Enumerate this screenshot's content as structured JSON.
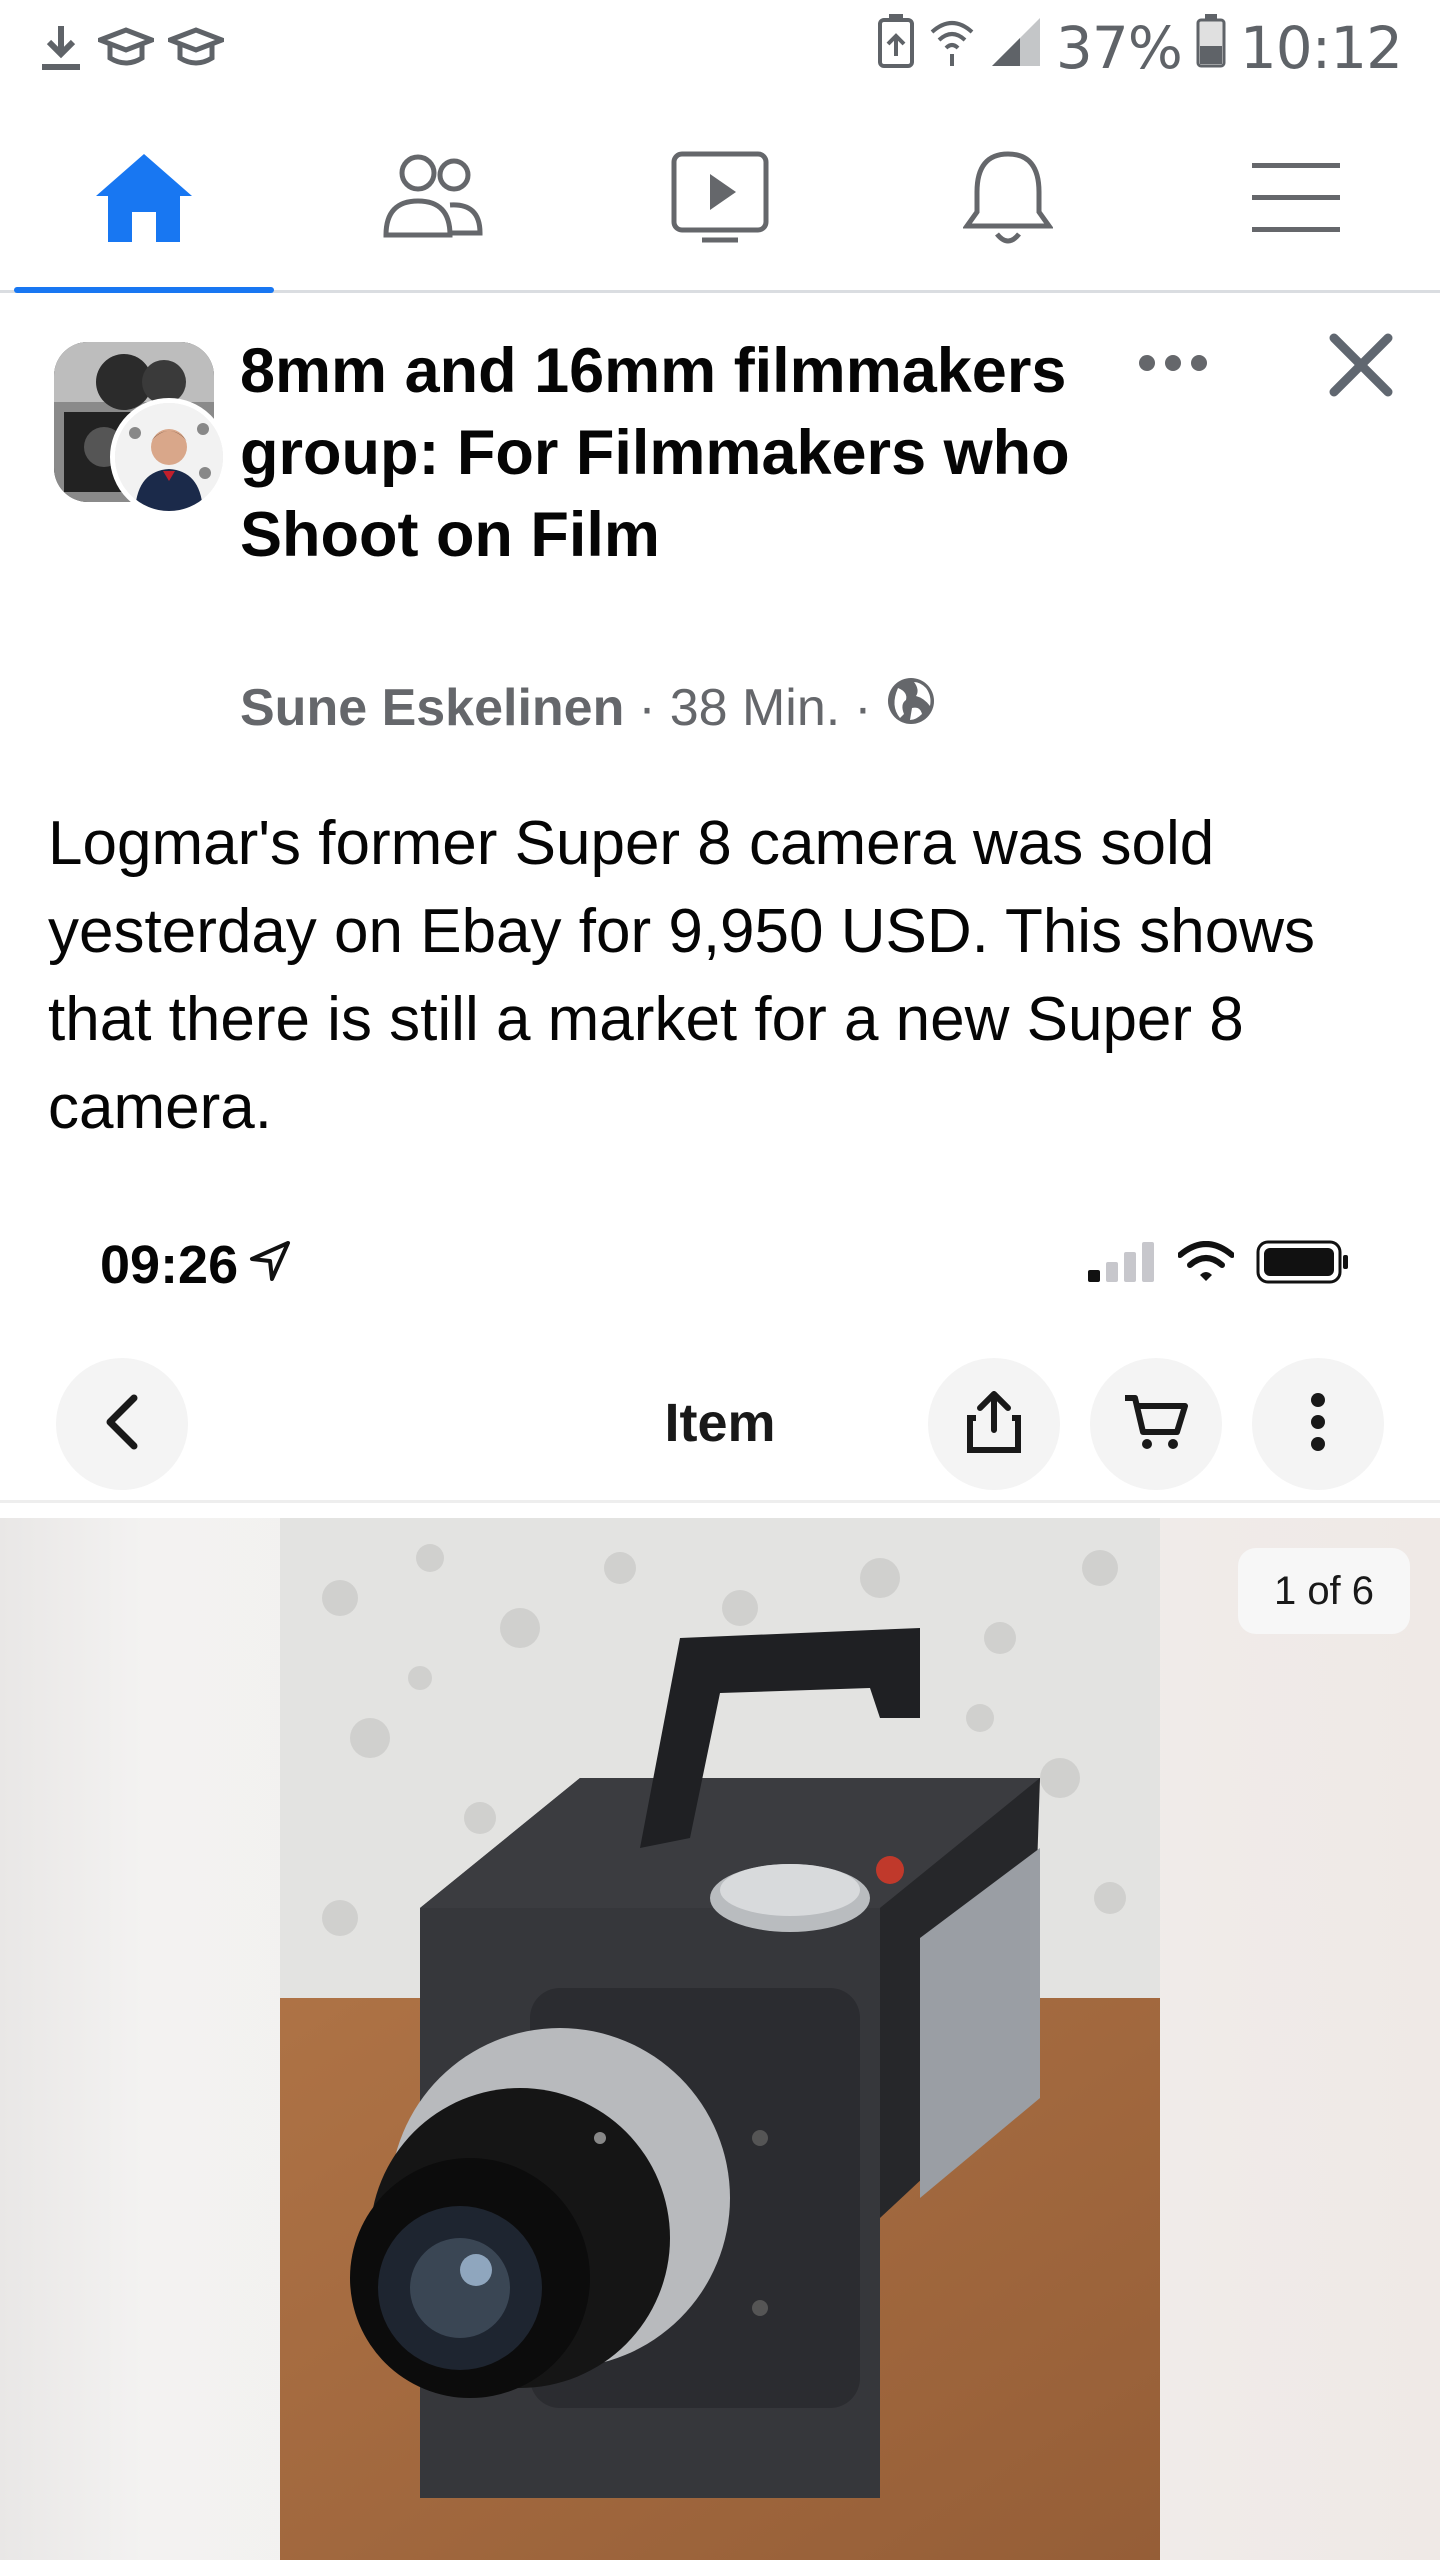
{
  "status_bar": {
    "battery": "37%",
    "time": "10:12",
    "left_icons": [
      "download-icon",
      "graduation-cap-icon",
      "graduation-cap-icon"
    ],
    "right_icons": [
      "battery-saver-icon",
      "wifi-calling-icon",
      "signal-icon",
      "battery-icon"
    ]
  },
  "nav": {
    "tabs": [
      {
        "icon": "home-icon",
        "active": true
      },
      {
        "icon": "friends-icon",
        "active": false
      },
      {
        "icon": "watch-icon",
        "active": false
      },
      {
        "icon": "notifications-bell-icon",
        "active": false
      },
      {
        "icon": "menu-icon",
        "active": false
      }
    ],
    "accent_color": "#1877f2"
  },
  "post": {
    "group_name": "8mm and 16mm filmmakers group: For Filmmakers who Shoot on Film",
    "author": "Sune Eskelinen",
    "separator": "·",
    "time_ago": "38 Min.",
    "privacy_icon": "globe-icon",
    "text": "Logmar's former Super 8 camera was sold yesterday on Ebay for 9,950 USD. This shows that there is still a market for a new Super 8 camera."
  },
  "embedded_screenshot": {
    "time": "09:26",
    "location_icon": "location-arrow-icon",
    "header_title": "Item",
    "buttons": [
      "back-icon",
      "share-icon",
      "cart-icon",
      "more-vertical-icon"
    ],
    "image_counter": "1 of 6",
    "photo_subject": "camera-photo"
  }
}
